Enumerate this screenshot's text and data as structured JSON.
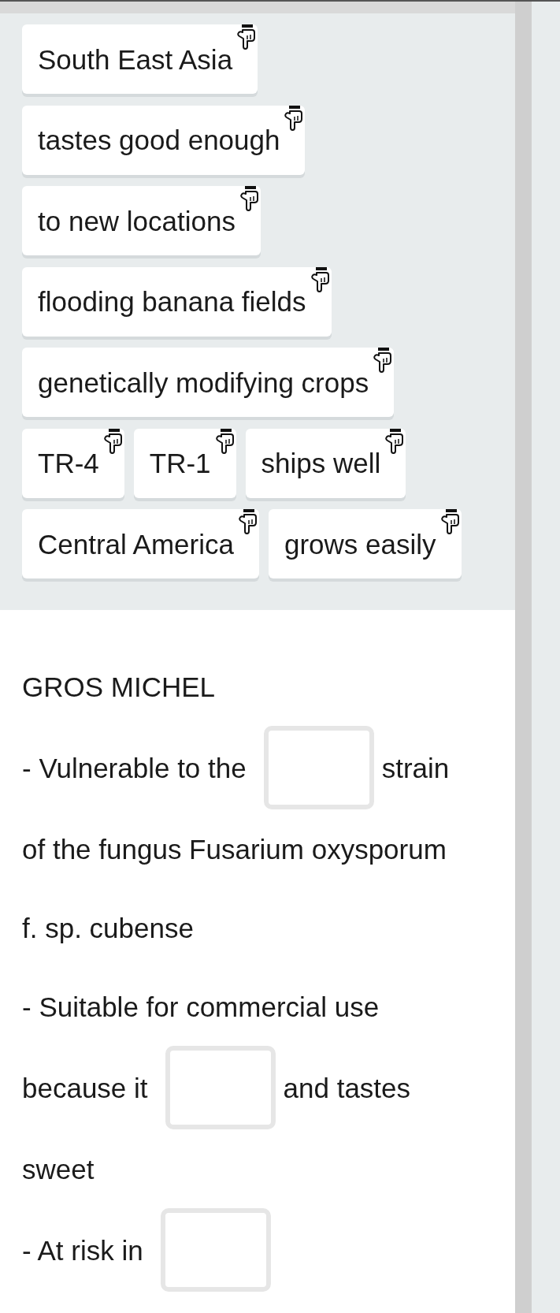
{
  "chip_bank": {
    "chips": [
      {
        "text": "South East Asia"
      },
      {
        "text": "tastes good enough"
      },
      {
        "text": "to new locations"
      },
      {
        "text": "flooding banana fields"
      },
      {
        "text": "genetically modifying crops"
      },
      {
        "text": "TR-4"
      },
      {
        "text": "TR-1"
      },
      {
        "text": "ships well"
      },
      {
        "text": "Central America"
      },
      {
        "text": "grows easily"
      }
    ]
  },
  "passage": {
    "title": "GROS MICHEL",
    "lines": [
      {
        "segments": [
          {
            "kind": "text",
            "text": "- Vulnerable to the"
          },
          {
            "kind": "blank"
          },
          {
            "kind": "text",
            "text": "strain"
          }
        ]
      },
      {
        "segments": [
          {
            "kind": "text",
            "text": "of the fungus Fusarium oxysporum"
          }
        ]
      },
      {
        "segments": [
          {
            "kind": "text",
            "text": "f. sp. cubense"
          }
        ]
      },
      {
        "segments": [
          {
            "kind": "text",
            "text": "- Suitable for commercial use"
          }
        ]
      },
      {
        "segments": [
          {
            "kind": "text",
            "text": "because it"
          },
          {
            "kind": "blank"
          },
          {
            "kind": "text",
            "text": "and tastes"
          }
        ]
      },
      {
        "segments": [
          {
            "kind": "text",
            "text": "sweet"
          }
        ]
      },
      {
        "segments": [
          {
            "kind": "text",
            "text": "- At risk in"
          },
          {
            "kind": "blank"
          }
        ]
      }
    ]
  }
}
